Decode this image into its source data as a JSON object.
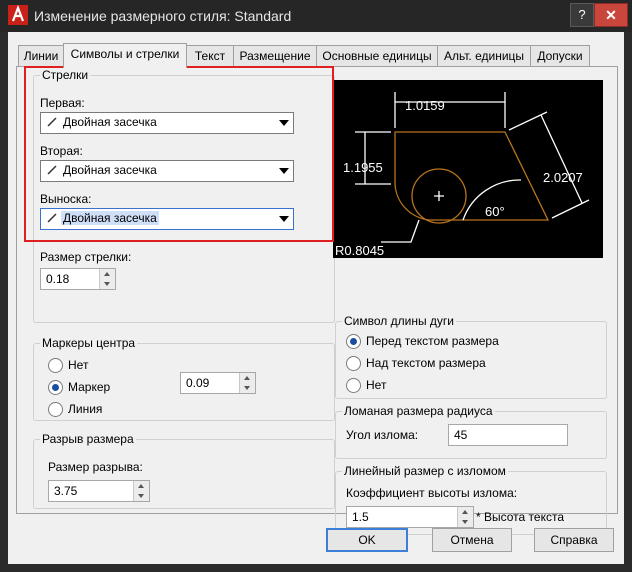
{
  "window": {
    "title": "Изменение размерного стиля: Standard",
    "help_glyph": "?",
    "close_glyph": "✕"
  },
  "tabs": [
    {
      "label": "Линии"
    },
    {
      "label": "Символы и стрелки"
    },
    {
      "label": "Текст"
    },
    {
      "label": "Размещение"
    },
    {
      "label": "Основные единицы"
    },
    {
      "label": "Альт. единицы"
    },
    {
      "label": "Допуски"
    }
  ],
  "arrows": {
    "group_title": "Стрелки",
    "first_label": "Первая:",
    "first_value": "Двойная засечка",
    "second_label": "Вторая:",
    "second_value": "Двойная засечка",
    "leader_label": "Выноска:",
    "leader_value": "Двойная засечка",
    "size_label": "Размер стрелки:",
    "size_value": "0.18"
  },
  "center_marks": {
    "group_title": "Маркеры центра",
    "options": [
      "Нет",
      "Маркер",
      "Линия"
    ],
    "selected": "Маркер",
    "size_value": "0.09"
  },
  "dim_break": {
    "group_title": "Разрыв размера",
    "size_label": "Размер разрыва:",
    "size_value": "3.75"
  },
  "preview": {
    "labels": {
      "top": "1.0159",
      "left": "1.1955",
      "right": "2.0207",
      "angle": "60°",
      "radius": "R0.8045"
    },
    "line_color": "#ffffff",
    "shape_color": "#b8741f"
  },
  "arc_length": {
    "group_title": "Символ длины дуги",
    "options": [
      "Перед текстом размера",
      "Над текстом размера",
      "Нет"
    ],
    "selected": "Перед текстом размера"
  },
  "radius_jog": {
    "group_title": "Ломаная размера радиуса",
    "angle_label": "Угол излома:",
    "angle_value": "45"
  },
  "linear_jog": {
    "group_title": "Линейный размер с изломом",
    "height_label": "Коэффициент высоты излома:",
    "height_value": "1.5",
    "suffix": "* Высота текста"
  },
  "buttons": {
    "ok": "OK",
    "cancel": "Отмена",
    "help": "Справка"
  },
  "colors": {
    "highlight_box": "#e02020",
    "accent": "#3b7fd9"
  }
}
